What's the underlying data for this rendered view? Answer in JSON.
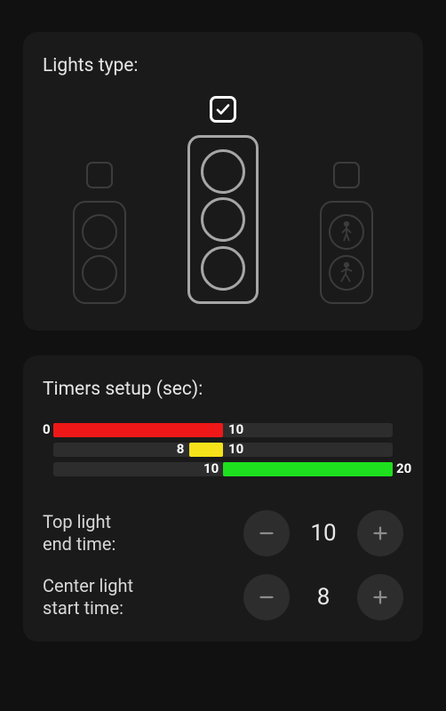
{
  "lightsType": {
    "title": "Lights type:",
    "options": [
      {
        "id": "two-light",
        "selected": false
      },
      {
        "id": "three-light",
        "selected": true
      },
      {
        "id": "pedestrian",
        "selected": false
      }
    ]
  },
  "timers": {
    "title": "Timers setup (sec):",
    "totalSeconds": 20,
    "segments": {
      "red": {
        "start": 0,
        "end": 10,
        "color": "#ef1818"
      },
      "yellow": {
        "start": 8,
        "end": 10,
        "color": "#f6e21a"
      },
      "green": {
        "start": 10,
        "end": 20,
        "color": "#1ee01e"
      }
    },
    "labels": {
      "redStart": "0",
      "redEnd": "10",
      "yellowStart": "8",
      "yellowEnd": "10",
      "greenStart": "10",
      "greenEnd": "20"
    },
    "steppers": [
      {
        "id": "top-end",
        "label": "Top light\nend time:",
        "value": 10
      },
      {
        "id": "center-start",
        "label": "Center light\nstart time:",
        "value": 8
      }
    ]
  }
}
